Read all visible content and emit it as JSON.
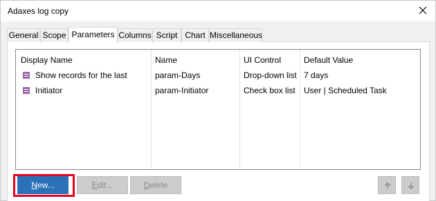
{
  "window": {
    "title": "Adaxes log copy"
  },
  "tabs": [
    {
      "label": "General"
    },
    {
      "label": "Scope"
    },
    {
      "label": "Parameters"
    },
    {
      "label": "Columns"
    },
    {
      "label": "Script"
    },
    {
      "label": "Chart"
    },
    {
      "label": "Miscellaneous"
    }
  ],
  "active_tab": "Parameters",
  "table": {
    "columns": [
      "Display Name",
      "Name",
      "UI Control",
      "Default Value"
    ],
    "rows": [
      {
        "display_name": "Show records for the last",
        "name": "param-Days",
        "ui_control": "Drop-down list",
        "default_value": "7 days"
      },
      {
        "display_name": "Initiator",
        "name": "param-Initiator",
        "ui_control": "Check box list",
        "default_value": "User | Scheduled Task"
      }
    ]
  },
  "buttons": {
    "new": {
      "mnemonic": "N",
      "rest": "ew..."
    },
    "edit": {
      "mnemonic": "E",
      "rest": "dit..."
    },
    "delete": {
      "mnemonic": "D",
      "rest": "elete"
    }
  },
  "icons": {
    "close": "close-icon",
    "parameter": "parameter-icon",
    "move_up": "arrow-up-icon",
    "move_down": "arrow-down-icon"
  },
  "colors": {
    "primary_button": "#2b71b8",
    "highlight": "#e8001c",
    "parameter_icon": "#9b6aa6"
  }
}
